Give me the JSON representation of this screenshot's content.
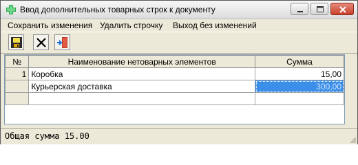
{
  "window": {
    "title": "Ввод дополнительных товарных строк к документу"
  },
  "menu": {
    "items": [
      {
        "label": "Сохранить изменения"
      },
      {
        "label": "Удалить строчку"
      },
      {
        "label": "Выход без изменений"
      }
    ]
  },
  "toolbar": {
    "buttons": [
      {
        "icon": "save-icon"
      },
      {
        "icon": "delete-icon"
      },
      {
        "icon": "exit-door-icon"
      }
    ]
  },
  "grid": {
    "columns": [
      "№",
      "Наименование нетоварных элементов",
      "Сумма"
    ],
    "rows": [
      {
        "n": "1",
        "name": "Коробка",
        "sum": "15,00"
      },
      {
        "n": "",
        "name": "Курьерская доставка",
        "sum": "300,00"
      },
      {
        "n": "",
        "name": "",
        "sum": ""
      }
    ]
  },
  "status": {
    "text": "Общая сумма 15.00"
  },
  "colors": {
    "selection": "#3c8fe8",
    "window_bg": "#ece9d8",
    "close_button": "#c7402c"
  }
}
